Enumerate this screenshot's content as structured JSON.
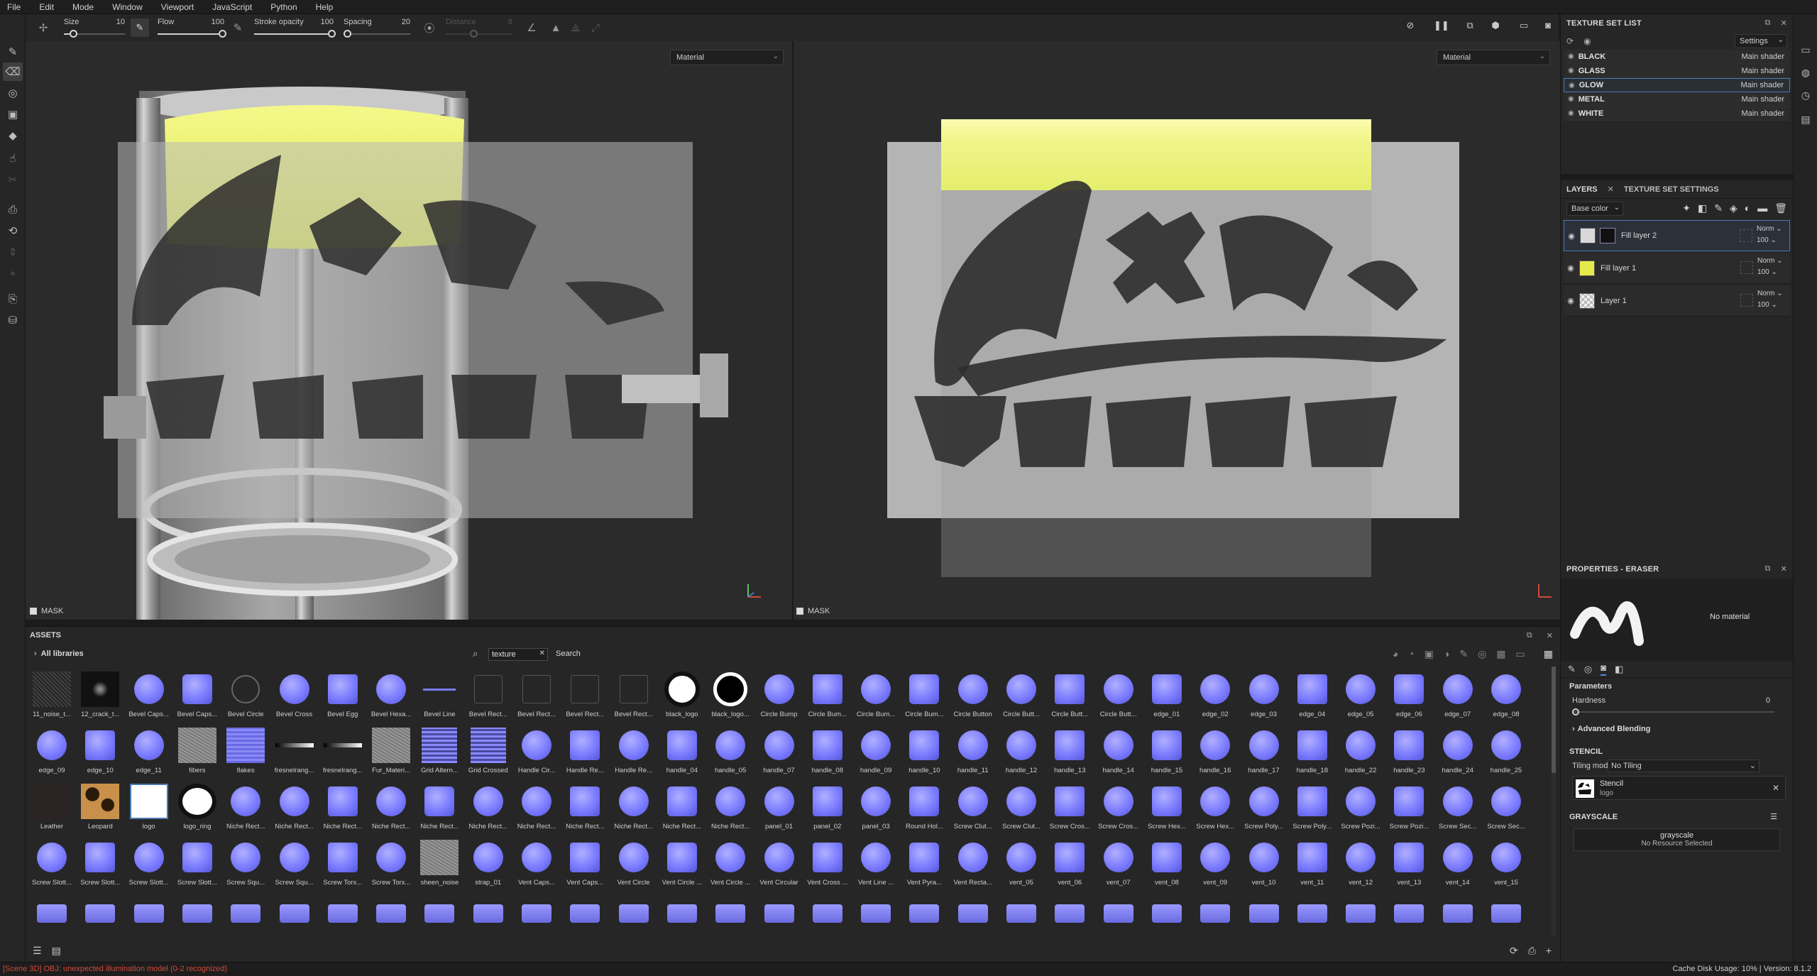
{
  "menu": [
    "File",
    "Edit",
    "Mode",
    "Window",
    "Viewport",
    "JavaScript",
    "Python",
    "Help"
  ],
  "tool_options": {
    "size": {
      "label": "Size",
      "value": "10",
      "level": 0.1
    },
    "flow": {
      "label": "Flow",
      "value": "100",
      "level": 1.0
    },
    "stroke_opacity": {
      "label": "Stroke opacity",
      "value": "100",
      "level": 1.0
    },
    "spacing": {
      "label": "Spacing",
      "value": "20",
      "level": 0.0
    },
    "distance": {
      "label": "Distance",
      "value": "8",
      "level": 0.4
    }
  },
  "viewport_3d": {
    "mode_select": "Material",
    "mask_label": "MASK"
  },
  "viewport_2d": {
    "mode_select": "Material",
    "mask_label": "MASK"
  },
  "texture_set_list": {
    "title": "TEXTURE SET LIST",
    "settings_label": "Settings",
    "sets": [
      {
        "name": "BLACK",
        "shader": "Main shader",
        "selected": false
      },
      {
        "name": "GLASS",
        "shader": "Main shader",
        "selected": false
      },
      {
        "name": "GLOW",
        "shader": "Main shader",
        "selected": true
      },
      {
        "name": "METAL",
        "shader": "Main shader",
        "selected": false
      },
      {
        "name": "WHITE",
        "shader": "Main shader",
        "selected": false
      }
    ]
  },
  "layers_panel": {
    "tab_layers": "LAYERS",
    "tab_texture_set_settings": "TEXTURE SET SETTINGS",
    "channel_select": "Base color",
    "layers": [
      {
        "name": "Fill layer 2",
        "blend": "Norm",
        "opacity": "100",
        "thumb_color": "#d8d8d8",
        "selected": true
      },
      {
        "name": "Fill layer 1",
        "blend": "Norm",
        "opacity": "100",
        "thumb_color": "#e4ea4a",
        "selected": false
      },
      {
        "name": "Layer 1",
        "blend": "Norm",
        "opacity": "100",
        "thumb_color": "#cfcfcf",
        "selected": false
      }
    ]
  },
  "properties": {
    "title": "PROPERTIES - ERASER",
    "no_material": "No material",
    "parameters_label": "Parameters",
    "hardness_label": "Hardness",
    "hardness_value": "0",
    "advanced_blending": "Advanced Blending",
    "stencil_title": "STENCIL",
    "tiling_mode_label": "Tiling mode",
    "tiling_mode_value": "No Tiling",
    "stencil_name": "Stencil",
    "stencil_sub": "logo",
    "grayscale_title": "GRAYSCALE",
    "grayscale_name": "grayscale",
    "grayscale_sub": "No Resource Selected"
  },
  "assets": {
    "title": "ASSETS",
    "all_libraries": "All libraries",
    "search_value": "texture",
    "search_label": "Search",
    "rows": [
      [
        "11_noise_t...",
        "12_crack_t...",
        "Bevel Caps...",
        "Bevel Caps...",
        "Bevel Circle",
        "Bevel Cross",
        "Bevel Egg",
        "Bevel Hexa...",
        "Bevel Line",
        "Bevel Rect...",
        "Bevel Rect...",
        "Bevel Rect...",
        "Bevel Rect...",
        "black_logo",
        "black_logo...",
        "Circle Bump",
        "Circle Bum...",
        "Circle Bum...",
        "Circle Bum...",
        "Circle Button",
        "Circle Butt...",
        "Circle Butt...",
        "Circle Butt...",
        "edge_01",
        "edge_02",
        "edge_03",
        "edge_04",
        "edge_05",
        "edge_06",
        "edge_07",
        "edge_08"
      ],
      [
        "edge_09",
        "edge_10",
        "edge_11",
        "fibers",
        "flakes",
        "fresnelrang...",
        "fresnelrang...",
        "Fur_Materi...",
        "Grid Altern...",
        "Grid Crossed",
        "Handle Cir...",
        "Handle Re...",
        "Handle Re...",
        "handle_04",
        "handle_05",
        "handle_07",
        "handle_08",
        "handle_09",
        "handle_10",
        "handle_11",
        "handle_12",
        "handle_13",
        "handle_14",
        "handle_15",
        "handle_16",
        "handle_17",
        "handle_18",
        "handle_22",
        "handle_23",
        "handle_24",
        "handle_25"
      ],
      [
        "Leather",
        "Leopard",
        "logo",
        "logo_ring",
        "Niche Rect...",
        "Niche Rect...",
        "Niche Rect...",
        "Niche Rect...",
        "Niche Rect...",
        "Niche Rect...",
        "Niche Rect...",
        "Niche Rect...",
        "Niche Rect...",
        "Niche Rect...",
        "Niche Rect...",
        "panel_01",
        "panel_02",
        "panel_03",
        "Round Hol...",
        "Screw Clut...",
        "Screw Clut...",
        "Screw Cros...",
        "Screw Cros...",
        "Screw Hex...",
        "Screw Hex...",
        "Screw Poly...",
        "Screw Poly...",
        "Screw Pozi...",
        "Screw Pozi...",
        "Screw Sec...",
        "Screw Sec..."
      ],
      [
        "Screw Slott...",
        "Screw Slott...",
        "Screw Slott...",
        "Screw Slott...",
        "Screw Squ...",
        "Screw Squ...",
        "Screw Torx...",
        "Screw Torx...",
        "sheen_noise",
        "strap_01",
        "Vent Caps...",
        "Vent Caps...",
        "Vent Circle",
        "Vent Circle ...",
        "Vent Circle ...",
        "Vent Circular",
        "Vent Cross ...",
        "Vent Line ...",
        "Vent Pyra...",
        "Vent Recta...",
        "vent_05",
        "vent_06",
        "vent_07",
        "vent_08",
        "vent_09",
        "vent_10",
        "vent_11",
        "vent_12",
        "vent_13",
        "vent_14",
        "vent_15"
      ],
      [
        "",
        "",
        "",
        "",
        "",
        "",
        "",
        "",
        "",
        "",
        "",
        "",
        "",
        "",
        "",
        "",
        "",
        "",
        "",
        "",
        "",
        "",
        "",
        "",
        "",
        "",
        "",
        "",
        "",
        "",
        ""
      ]
    ]
  },
  "status": {
    "error": "[Scene 3D] OBJ: unexpected illumination model (0-2 recognized)",
    "right": "Cache Disk Usage:   10% | Version: 8.1.2"
  },
  "colors": {
    "accent": "#4a79b3",
    "glow": "#e6f06a",
    "normal_map": "#7b7bff",
    "error": "#d04a3a"
  }
}
